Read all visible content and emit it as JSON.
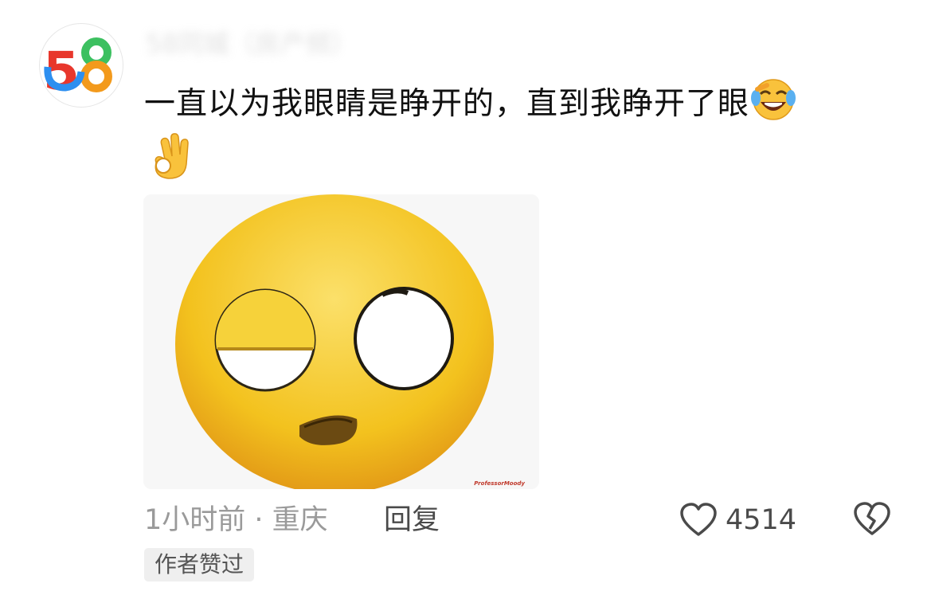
{
  "comment": {
    "avatar_icon": "58-logo-icon",
    "username": "58同城（房产频）",
    "text": "一直以为我眼睛是睁开的，直到我睁开了眼",
    "emojis": [
      "face-with-tears-of-joy-icon",
      "ok-hand-icon"
    ],
    "image_icon": "emoji-one-eye-open-icon",
    "image_watermark": "ProfessorMoody",
    "time_location": "1小时前 · 重庆",
    "reply_label": "回复",
    "like_count": "4514",
    "author_badge": "作者赞过"
  },
  "colors": {
    "text": "#111111",
    "muted": "#9a9a9a",
    "secondary": "#4a4a4a",
    "badge_bg": "#efefef",
    "logo_red": "#e8372c",
    "logo_blue": "#2d8ff0",
    "logo_green": "#3cc060",
    "logo_orange": "#f39a1c"
  }
}
